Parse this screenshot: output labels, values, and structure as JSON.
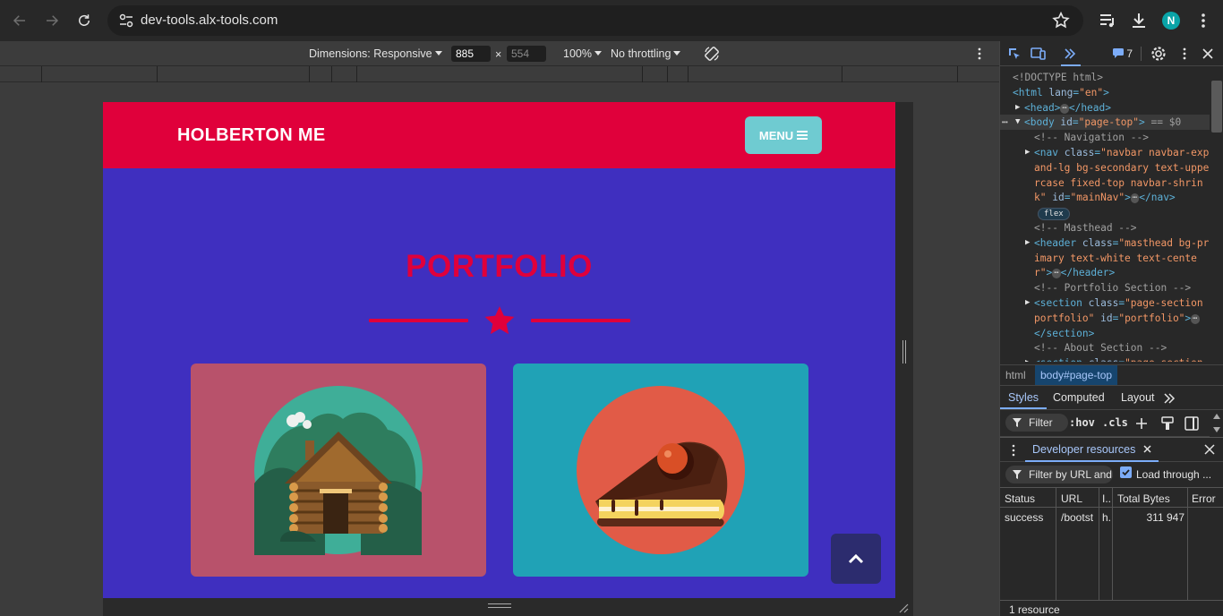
{
  "browser": {
    "url": "dev-tools.alx-tools.com",
    "avatar_letter": "N"
  },
  "device_toolbar": {
    "dimensions_label": "Dimensions: Responsive",
    "width_value": "885",
    "times": "×",
    "height_value": "554",
    "zoom": "100%",
    "throttling": "No throttling"
  },
  "site": {
    "brand": "HOLBERTON ME",
    "menu_label": "MENU",
    "section_title": "PORTFOLIO",
    "colors": {
      "primary": "#e0003b",
      "secondary": "#3f2fbf",
      "menu": "#6fcbd1",
      "card1": "#b8526b",
      "card2": "#20a2b6"
    }
  },
  "devtools": {
    "issues_count": "7",
    "dom_lines": [
      {
        "indent": 14,
        "parts": [
          [
            "cmt",
            "<!DOCTYPE html>"
          ]
        ]
      },
      {
        "indent": 14,
        "parts": [
          [
            "tag",
            "<html "
          ],
          [
            "attr",
            "lang"
          ],
          [
            "tag",
            "="
          ],
          [
            "val",
            "\"en\""
          ],
          [
            "tag",
            ">"
          ]
        ]
      },
      {
        "indent": 27,
        "tri": "▶",
        "parts": [
          [
            "tag",
            "<head>"
          ],
          [
            "ell",
            "⋯"
          ],
          [
            "tag",
            "</head>"
          ]
        ]
      },
      {
        "indent": 27,
        "tri": "▼",
        "sel": true,
        "parts": [
          [
            "tag",
            "<body "
          ],
          [
            "attr",
            "id"
          ],
          [
            "tag",
            "="
          ],
          [
            "val",
            "\"page-top\""
          ],
          [
            "tag",
            ">"
          ],
          [
            "cmt",
            " == $0"
          ]
        ]
      },
      {
        "indent": 38,
        "parts": [
          [
            "cmt",
            "<!-- Navigation -->"
          ]
        ]
      },
      {
        "indent": 38,
        "tri": "▶",
        "parts": [
          [
            "tag",
            "<nav "
          ],
          [
            "attr",
            "class"
          ],
          [
            "tag",
            "="
          ],
          [
            "val",
            "\"navbar navbar-exp"
          ]
        ]
      },
      {
        "indent": 38,
        "parts": [
          [
            "val",
            "and-lg bg-secondary text-uppe"
          ]
        ]
      },
      {
        "indent": 38,
        "parts": [
          [
            "val",
            "rcase fixed-top navbar-shrin"
          ]
        ]
      },
      {
        "indent": 38,
        "parts": [
          [
            "val",
            "k\" "
          ],
          [
            "attr",
            "id"
          ],
          [
            "tag",
            "="
          ],
          [
            "val",
            "\"mainNav\""
          ],
          [
            "tag",
            ">"
          ],
          [
            "ell",
            "⋯"
          ],
          [
            "tag",
            "</nav>"
          ]
        ]
      },
      {
        "indent": 42,
        "parts": [
          [
            "badge",
            "flex"
          ]
        ]
      },
      {
        "indent": 38,
        "parts": [
          [
            "cmt",
            "<!-- Masthead -->"
          ]
        ]
      },
      {
        "indent": 38,
        "tri": "▶",
        "parts": [
          [
            "tag",
            "<header "
          ],
          [
            "attr",
            "class"
          ],
          [
            "tag",
            "="
          ],
          [
            "val",
            "\"masthead bg-pr"
          ]
        ]
      },
      {
        "indent": 38,
        "parts": [
          [
            "val",
            "imary text-white text-cente"
          ]
        ]
      },
      {
        "indent": 38,
        "parts": [
          [
            "val",
            "r\""
          ],
          [
            "tag",
            ">"
          ],
          [
            "ell",
            "⋯"
          ],
          [
            "tag",
            "</header>"
          ]
        ]
      },
      {
        "indent": 38,
        "parts": [
          [
            "cmt",
            "<!-- Portfolio Section -->"
          ]
        ]
      },
      {
        "indent": 38,
        "tri": "▶",
        "parts": [
          [
            "tag",
            "<section "
          ],
          [
            "attr",
            "class"
          ],
          [
            "tag",
            "="
          ],
          [
            "val",
            "\"page-section"
          ]
        ]
      },
      {
        "indent": 38,
        "parts": [
          [
            "val",
            "portfolio\" "
          ],
          [
            "attr",
            "id"
          ],
          [
            "tag",
            "="
          ],
          [
            "val",
            "\"portfolio\""
          ],
          [
            "tag",
            ">"
          ],
          [
            "ell",
            "⋯"
          ]
        ]
      },
      {
        "indent": 38,
        "parts": [
          [
            "tag",
            "</section>"
          ]
        ]
      },
      {
        "indent": 38,
        "parts": [
          [
            "cmt",
            "<!-- About Section -->"
          ]
        ]
      },
      {
        "indent": 38,
        "tri": "▶",
        "parts": [
          [
            "tag",
            "<section "
          ],
          [
            "attr",
            "class"
          ],
          [
            "tag",
            "="
          ],
          [
            "val",
            "\"page-section"
          ]
        ]
      }
    ],
    "breadcrumb": [
      "html",
      "body#page-top"
    ],
    "style_tabs": [
      "Styles",
      "Computed",
      "Layout"
    ],
    "filter_label": "Filter",
    "hov": ":hov",
    "cls": ".cls",
    "drawer_title": "Developer resources",
    "drawer_filter": "Filter by URL and",
    "load_through": "Load through ...",
    "columns": [
      "Status",
      "URL",
      "I..",
      "Total Bytes",
      "Error"
    ],
    "row": {
      "status": "success",
      "url": "/bootst",
      "initiator": "h.",
      "bytes": "311 947",
      "error": ""
    },
    "footer": "1 resource"
  }
}
